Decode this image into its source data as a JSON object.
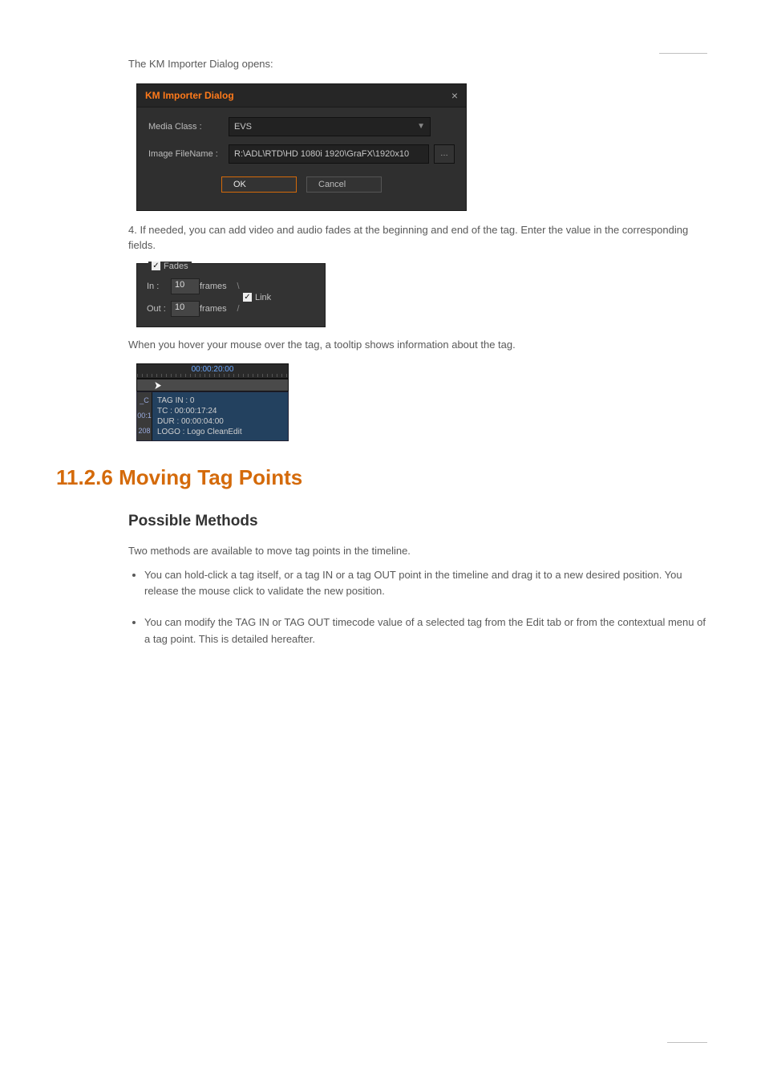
{
  "header": {
    "right_text": ""
  },
  "paragraphs": {
    "p1": "The KM Importer Dialog opens:",
    "p2": "4. If needed, you can add video and audio fades at the beginning and end of the tag. Enter the value in the corresponding fields.",
    "p3": "When you hover your mouse over the tag, a tooltip shows information about the tag.",
    "moving_intro": "Two methods are available to move tag points in the timeline.",
    "bullet1": "You can hold-click a tag itself, or a tag IN or a tag OUT point in the timeline and drag it to a new desired position. You release the mouse click to validate the new position.",
    "bullet2": "You can modify the TAG IN or TAG OUT timecode value of a selected tag from the Edit tab or from the contextual menu of a tag point. This is detailed hereafter."
  },
  "dialog": {
    "title": "KM Importer Dialog",
    "close_glyph": "×",
    "media_class_label": "Media Class :",
    "media_class_value": "EVS",
    "image_filename_label": "Image FileName :",
    "image_filename_value": "R:\\ADL\\RTD\\HD 1080i 1920\\GraFX\\1920x10",
    "browse_label": "…",
    "ok_label": "OK",
    "cancel_label": "Cancel"
  },
  "fades": {
    "legend_label": "Fades",
    "in_label": "In :",
    "in_value": "10",
    "out_label": "Out :",
    "out_value": "10",
    "frames_label": "frames",
    "link_label": "Link",
    "slash_in": "\\",
    "slash_out": "/"
  },
  "tooltip": {
    "ruler_tc": "00:00:20:00",
    "left_c": "_C",
    "left_t1": "00:1",
    "left_t2": "208",
    "l1": "TAG IN : 0",
    "l2": "TC : 00:00:17:24",
    "l3": "DUR : 00:00:04:00",
    "l4": "LOGO : Logo CleanEdit"
  },
  "headings": {
    "h2": "11.2.6 Moving Tag Points",
    "h3": "Possible Methods"
  },
  "footer": {
    "text": ""
  }
}
